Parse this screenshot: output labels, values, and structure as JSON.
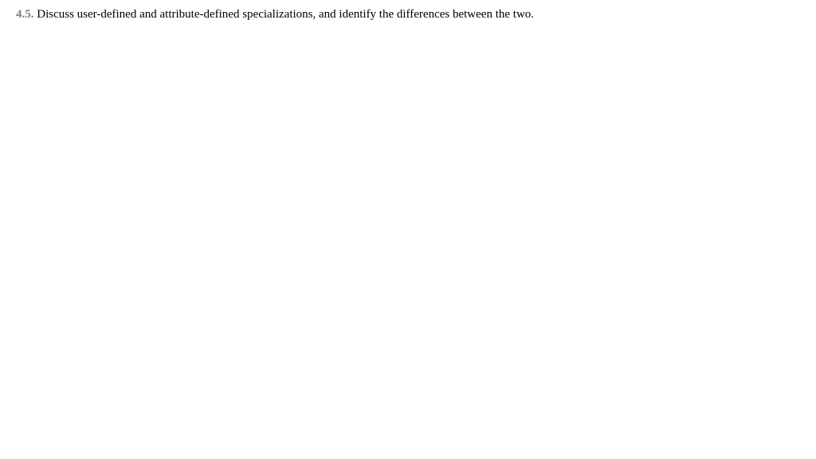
{
  "question": {
    "number": "4.5.",
    "text": "Discuss user-defined and attribute-defined specializations, and identify the differences between the two."
  }
}
